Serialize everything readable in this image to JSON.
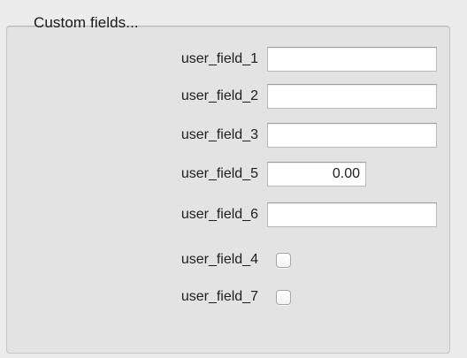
{
  "group": {
    "title": "Custom fields..."
  },
  "fields": [
    {
      "label": "user_field_1",
      "type": "text",
      "value": ""
    },
    {
      "label": "user_field_2",
      "type": "text",
      "value": ""
    },
    {
      "label": "user_field_3",
      "type": "text",
      "value": ""
    },
    {
      "label": "user_field_5",
      "type": "number",
      "value": "0.00"
    },
    {
      "label": "user_field_6",
      "type": "text",
      "value": ""
    },
    {
      "label": "user_field_4",
      "type": "checkbox",
      "checked": false
    },
    {
      "label": "user_field_7",
      "type": "checkbox",
      "checked": false
    }
  ]
}
